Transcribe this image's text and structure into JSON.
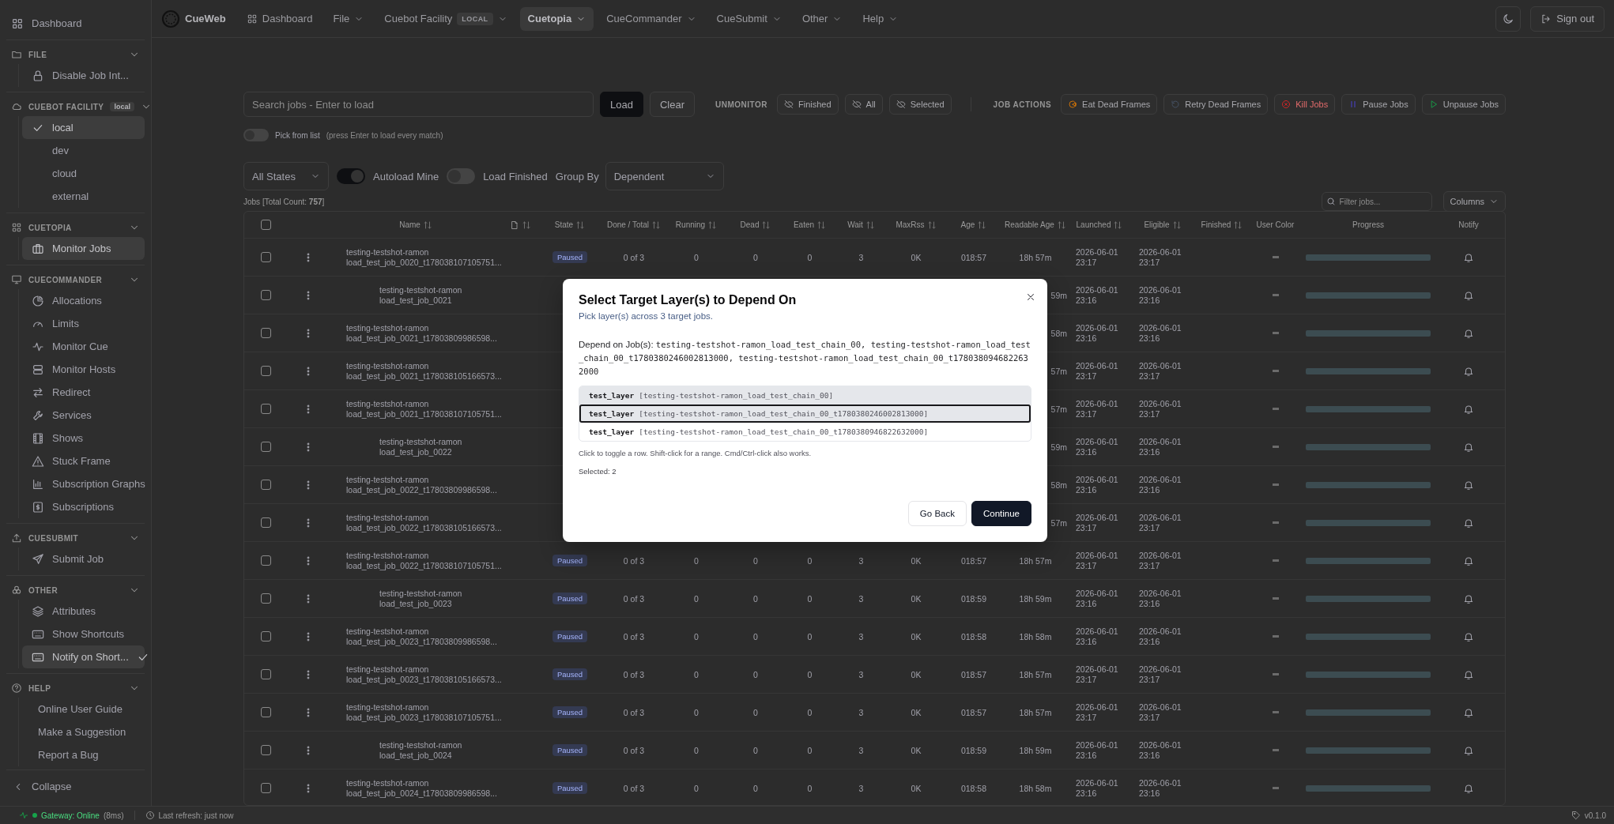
{
  "sidebar": {
    "dashboard": {
      "label": "Dashboard",
      "selected": false
    },
    "sections": [
      {
        "title": "FILE",
        "expanded": true,
        "items": [
          {
            "label": "Disable Job Int...",
            "selected": false
          }
        ]
      },
      {
        "title": "CUEBOT FACILITY",
        "badge": "local",
        "expanded": true,
        "items": [
          {
            "label": "local",
            "kind": "option",
            "checked": true,
            "selected": true
          },
          {
            "label": "dev",
            "kind": "option",
            "checked": false,
            "selected": false
          },
          {
            "label": "cloud",
            "kind": "option",
            "checked": false,
            "selected": false
          },
          {
            "label": "external",
            "kind": "option",
            "checked": false,
            "selected": false
          }
        ]
      },
      {
        "title": "CUETOPIA",
        "expanded": true,
        "items": [
          {
            "label": "Monitor Jobs",
            "selected": true
          }
        ]
      },
      {
        "title": "CUECOMMANDER",
        "expanded": true,
        "items": [
          {
            "label": "Allocations",
            "selected": false
          },
          {
            "label": "Limits",
            "selected": false
          },
          {
            "label": "Monitor Cue",
            "selected": false
          },
          {
            "label": "Monitor Hosts",
            "selected": false
          },
          {
            "label": "Redirect",
            "selected": false
          },
          {
            "label": "Services",
            "selected": false
          },
          {
            "label": "Shows",
            "selected": false
          },
          {
            "label": "Stuck Frame",
            "selected": false
          },
          {
            "label": "Subscription Graphs",
            "selected": false
          },
          {
            "label": "Subscriptions",
            "selected": false
          }
        ]
      },
      {
        "title": "CUESUBMIT",
        "expanded": true,
        "items": [
          {
            "label": "Submit Job",
            "selected": false
          }
        ]
      },
      {
        "title": "OTHER",
        "expanded": true,
        "items": [
          {
            "label": "Attributes",
            "selected": false
          },
          {
            "label": "Show Shortcuts",
            "selected": false
          },
          {
            "label": "Notify on Short...",
            "kind": "toggle",
            "checked": true,
            "selected": true
          }
        ]
      },
      {
        "title": "HELP",
        "expanded": true,
        "items": [
          {
            "label": "Online User Guide",
            "selected": false
          },
          {
            "label": "Make a Suggestion",
            "selected": false
          },
          {
            "label": "Report a Bug",
            "selected": false
          }
        ]
      }
    ],
    "collapse": "Collapse"
  },
  "topnav": {
    "brand": "CueWeb",
    "items": [
      {
        "label": "Dashboard",
        "kind": "link",
        "selected": false
      },
      {
        "label": "File",
        "kind": "menu",
        "selected": false
      },
      {
        "label": "Cuebot Facility",
        "badge": "LOCAL",
        "kind": "menu",
        "selected": false
      },
      {
        "label": "Cuetopia",
        "kind": "menu",
        "selected": true
      },
      {
        "label": "CueCommander",
        "kind": "menu",
        "selected": false
      },
      {
        "label": "CueSubmit",
        "kind": "menu",
        "selected": false
      },
      {
        "label": "Other",
        "kind": "menu",
        "selected": false
      },
      {
        "label": "Help",
        "kind": "menu",
        "selected": false
      }
    ],
    "sign_out": "Sign out"
  },
  "toolbar": {
    "search": {
      "placeholder": "Search jobs - Enter to load"
    },
    "load": "Load",
    "clear": "Clear",
    "unmonitor": {
      "label": "UNMONITOR",
      "buttons": [
        "Finished",
        "All",
        "Selected"
      ]
    },
    "job_actions": {
      "label": "JOB ACTIONS",
      "buttons": [
        {
          "label": "Eat Dead Frames",
          "kind": "eat"
        },
        {
          "label": "Retry Dead Frames",
          "kind": "retry"
        },
        {
          "label": "Kill Jobs",
          "kind": "kill"
        },
        {
          "label": "Pause Jobs",
          "kind": "pause"
        },
        {
          "label": "Unpause Jobs",
          "kind": "unpause"
        }
      ]
    },
    "pick_from_list": {
      "label": "Pick from list",
      "hint": "(press Enter to load every match)",
      "on": false
    }
  },
  "filters": {
    "state": "All States",
    "autoload_mine": {
      "label": "Autoload Mine",
      "on": true
    },
    "load_finished": {
      "label": "Load Finished",
      "on": false
    },
    "group_by_label": "Group By",
    "group_by": "Dependent"
  },
  "jobs_count": "Jobs [Total Count: **757**]",
  "filter_field": {
    "placeholder": "Filter jobs..."
  },
  "columns_button": "Columns",
  "table": {
    "all_checked": false,
    "columns": [
      "Name",
      "",
      "State",
      "Done / Total",
      "Running",
      "Dead",
      "Eaten",
      "Wait",
      "MaxRss",
      "Age",
      "Readable Age",
      "Launched",
      "Eligible",
      "Finished",
      "User Color",
      "Progress",
      "Notify"
    ],
    "rows": [
      {
        "name": [
          "testing-testshot-ramon",
          "load_test_job_0020_t178038107105751..."
        ],
        "checked": false,
        "state": "Paused",
        "done": "0 of 3",
        "running": "0",
        "dead": "0",
        "eaten": "0",
        "wait": "3",
        "maxrss": "0K",
        "age": "018:57",
        "readable_age": "18h 57m",
        "launched": [
          "2026-06-01",
          "23:17"
        ],
        "eligible": [
          "2026-06-01",
          "23:17"
        ],
        "level": 0,
        "children": [
          {
            "name": [
              "testing-testshot-ramon",
              "load_test_job_0021"
            ],
            "checked": false,
            "readable_age": "59m",
            "launched": [
              "2026-06-01",
              "23:16"
            ],
            "eligible": [
              "2026-06-01",
              "23:16"
            ],
            "level": 0
          }
        ]
      },
      {
        "name": [
          "testing-testshot-ramon",
          "load_test_job_0021_t17803809986598..."
        ],
        "checked": false,
        "readable_age": "58m",
        "launched": [
          "2026-06-01",
          "23:16"
        ],
        "eligible": [
          "2026-06-01",
          "23:16"
        ],
        "level": 0
      },
      {
        "name": [
          "testing-testshot-ramon",
          "load_test_job_0021_t178038105166573..."
        ],
        "checked": false,
        "readable_age": "57m",
        "launched": [
          "2026-06-01",
          "23:17"
        ],
        "eligible": [
          "2026-06-01",
          "23:17"
        ],
        "level": 0
      },
      {
        "name": [
          "testing-testshot-ramon",
          "load_test_job_0021_t178038107105751..."
        ],
        "checked": false,
        "readable_age": "57m",
        "launched": [
          "2026-06-01",
          "23:17"
        ],
        "eligible": [
          "2026-06-01",
          "23:17"
        ],
        "level": 0,
        "children": [
          {
            "name": [
              "testing-testshot-ramon",
              "load_test_job_0022"
            ],
            "checked": false,
            "readable_age": "59m",
            "launched": [
              "2026-06-01",
              "23:16"
            ],
            "eligible": [
              "2026-06-01",
              "23:16"
            ],
            "level": 0
          }
        ]
      },
      {
        "name": [
          "testing-testshot-ramon",
          "load_test_job_0022_t17803809986598..."
        ],
        "checked": false,
        "readable_age": "58m",
        "launched": [
          "2026-06-01",
          "23:16"
        ],
        "eligible": [
          "2026-06-01",
          "23:16"
        ],
        "level": 0
      },
      {
        "name": [
          "testing-testshot-ramon",
          "load_test_job_0022_t178038105166573..."
        ],
        "checked": false,
        "readable_age": "57m",
        "launched": [
          "2026-06-01",
          "23:17"
        ],
        "eligible": [
          "2026-06-01",
          "23:17"
        ],
        "level": 0
      },
      {
        "name": [
          "testing-testshot-ramon",
          "load_test_job_0022_t178038107105751..."
        ],
        "checked": false,
        "state": "Paused",
        "done": "0 of 3",
        "running": "0",
        "dead": "0",
        "eaten": "0",
        "wait": "3",
        "maxrss": "0K",
        "age": "018:57",
        "readable_age": "18h 57m",
        "launched": [
          "2026-06-01",
          "23:17"
        ],
        "eligible": [
          "2026-06-01",
          "23:17"
        ],
        "level": 0,
        "children": [
          {
            "name": [
              "testing-testshot-ramon",
              "load_test_job_0023"
            ],
            "checked": false,
            "state": "Paused",
            "done": "0 of 3",
            "running": "0",
            "dead": "0",
            "eaten": "0",
            "wait": "3",
            "maxrss": "0K",
            "age": "018:59",
            "readable_age": "18h 59m",
            "launched": [
              "2026-06-01",
              "23:16"
            ],
            "eligible": [
              "2026-06-01",
              "23:16"
            ],
            "level": 0
          }
        ]
      },
      {
        "name": [
          "testing-testshot-ramon",
          "load_test_job_0023_t17803809986598..."
        ],
        "checked": false,
        "state": "Paused",
        "done": "0 of 3",
        "running": "0",
        "dead": "0",
        "eaten": "0",
        "wait": "3",
        "maxrss": "0K",
        "age": "018:58",
        "readable_age": "18h 58m",
        "launched": [
          "2026-06-01",
          "23:16"
        ],
        "eligible": [
          "2026-06-01",
          "23:16"
        ],
        "level": 0
      },
      {
        "name": [
          "testing-testshot-ramon",
          "load_test_job_0023_t178038105166573..."
        ],
        "checked": false,
        "state": "Paused",
        "done": "0 of 3",
        "running": "0",
        "dead": "0",
        "eaten": "0",
        "wait": "3",
        "maxrss": "0K",
        "age": "018:57",
        "readable_age": "18h 57m",
        "launched": [
          "2026-06-01",
          "23:17"
        ],
        "eligible": [
          "2026-06-01",
          "23:17"
        ],
        "level": 0
      },
      {
        "name": [
          "testing-testshot-ramon",
          "load_test_job_0023_t178038107105751..."
        ],
        "checked": false,
        "state": "Paused",
        "done": "0 of 3",
        "running": "0",
        "dead": "0",
        "eaten": "0",
        "wait": "3",
        "maxrss": "0K",
        "age": "018:57",
        "readable_age": "18h 57m",
        "launched": [
          "2026-06-01",
          "23:17"
        ],
        "eligible": [
          "2026-06-01",
          "23:17"
        ],
        "level": 0,
        "children": [
          {
            "name": [
              "testing-testshot-ramon",
              "load_test_job_0024"
            ],
            "checked": false,
            "state": "Paused",
            "done": "0 of 3",
            "running": "0",
            "dead": "0",
            "eaten": "0",
            "wait": "3",
            "maxrss": "0K",
            "age": "018:59",
            "readable_age": "18h 59m",
            "launched": [
              "2026-06-01",
              "23:16"
            ],
            "eligible": [
              "2026-06-01",
              "23:16"
            ],
            "level": 0
          }
        ]
      },
      {
        "name": [
          "testing-testshot-ramon",
          "load_test_job_0024_t17803809986598..."
        ],
        "checked": false,
        "state": "Paused",
        "done": "0 of 3",
        "running": "0",
        "dead": "0",
        "eaten": "0",
        "wait": "3",
        "maxrss": "0K",
        "age": "018:58",
        "readable_age": "18h 58m",
        "launched": [
          "2026-06-01",
          "23:16"
        ],
        "eligible": [
          "2026-06-01",
          "23:16"
        ],
        "level": 0
      }
    ]
  },
  "modal": {
    "title": "Select Target Layer(s) to Depend On",
    "subtitle": "Pick layer(s) across 3 target jobs.",
    "depend_label": "Depend on Job(s):",
    "depend_jobs": "testing-testshot-ramon_load_test_chain_00, testing-testshot-ramon_load_test_chain_00_t1780380246002813000, testing-testshot-ramon_load_test_chain_00_t1780380946822632000",
    "layers": [
      {
        "name": "test_layer",
        "job": "[testing-testshot-ramon_load_test_chain_00]",
        "selected": true,
        "focused": false
      },
      {
        "name": "test_layer",
        "job": "[testing-testshot-ramon_load_test_chain_00_t1780380246002813000]",
        "selected": true,
        "focused": true
      },
      {
        "name": "test_layer",
        "job": "[testing-testshot-ramon_load_test_chain_00_t1780380946822632000]",
        "selected": false,
        "focused": false
      }
    ],
    "hint": "Click to toggle a row. Shift-click for a range. Cmd/Ctrl-click also works.",
    "selected_count": "Selected: 2",
    "back": "Go Back",
    "continue": "Continue"
  },
  "status_bar": {
    "gateway": "Gateway: Online",
    "latency": "(8ms)",
    "refresh": "Last refresh: just now",
    "version": "v0.1.0"
  }
}
